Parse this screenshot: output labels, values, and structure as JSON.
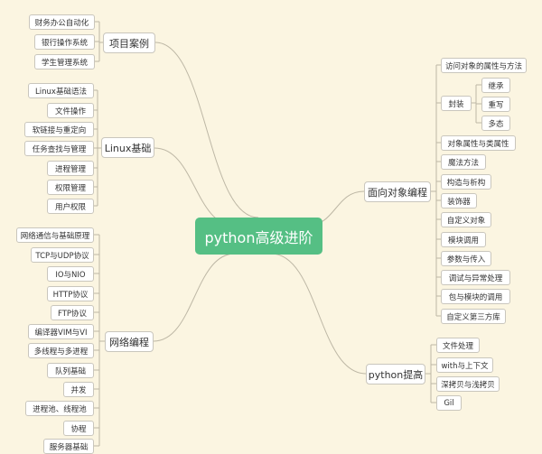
{
  "root": {
    "label": "python高级进阶"
  },
  "branches": [
    {
      "id": "projects",
      "label": "项目案例",
      "children": [
        {
          "label": "财务办公自动化"
        },
        {
          "label": "银行操作系统"
        },
        {
          "label": "学生管理系统"
        }
      ]
    },
    {
      "id": "linux",
      "label": "Linux基础",
      "children": [
        {
          "label": "Linux基础语法"
        },
        {
          "label": "文件操作"
        },
        {
          "label": "软链接与重定向"
        },
        {
          "label": "任务查找与管理"
        },
        {
          "label": "进程管理"
        },
        {
          "label": "权限管理"
        },
        {
          "label": "用户权限"
        }
      ]
    },
    {
      "id": "network",
      "label": "网络编程",
      "children": [
        {
          "label": "网络通信与基础原理"
        },
        {
          "label": "TCP与UDP协议"
        },
        {
          "label": "IO与NIO"
        },
        {
          "label": "HTTP协议"
        },
        {
          "label": "FTP协议"
        },
        {
          "label": "编译器VIM与VI"
        },
        {
          "label": "多线程与多进程"
        },
        {
          "label": "队列基础"
        },
        {
          "label": "并发"
        },
        {
          "label": "进程池、线程池"
        },
        {
          "label": "协程"
        },
        {
          "label": "服务器基础"
        }
      ]
    },
    {
      "id": "oop",
      "label": "面向对象编程",
      "children": [
        {
          "label": "访问对象的属性与方法"
        },
        {
          "label": "封装",
          "children": [
            {
              "label": "继承"
            },
            {
              "label": "重写"
            },
            {
              "label": "多态"
            }
          ]
        },
        {
          "label": "对象属性与类属性"
        },
        {
          "label": "魔法方法"
        },
        {
          "label": "构造与析构"
        },
        {
          "label": "装饰器"
        },
        {
          "label": "自定义对象"
        },
        {
          "label": "模块调用"
        },
        {
          "label": "参数与传入"
        },
        {
          "label": "调试与异常处理"
        },
        {
          "label": "包与模块的调用"
        },
        {
          "label": "自定义第三方库"
        }
      ]
    },
    {
      "id": "advanced",
      "label": "python提高",
      "children": [
        {
          "label": "文件处理"
        },
        {
          "label": "with与上下文"
        },
        {
          "label": "深拷贝与浅拷贝"
        },
        {
          "label": "Gil"
        }
      ]
    }
  ],
  "colors": {
    "background": "#fbf5e1",
    "root": "#55bf84",
    "line": "#bdb7a5",
    "border": "#c9c6bd"
  }
}
